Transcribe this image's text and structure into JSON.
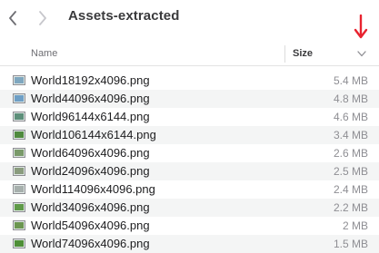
{
  "window": {
    "title": "Assets-extracted",
    "back_icon": "chevron-left-icon",
    "forward_icon": "chevron-right-icon"
  },
  "annotation": {
    "icon": "red-down-arrow-icon",
    "color": "#e8232f"
  },
  "table": {
    "columns": {
      "name": "Name",
      "size": "Size",
      "sort_icon": "chevron-down-icon"
    },
    "rows": [
      {
        "name": "World18192x4096.png",
        "size": "5.4 MB",
        "thumb_color": "#7fa7bf"
      },
      {
        "name": "World44096x4096.png",
        "size": "4.8 MB",
        "thumb_color": "#6e9fc6"
      },
      {
        "name": "World96144x6144.png",
        "size": "4.6 MB",
        "thumb_color": "#5d8f7a"
      },
      {
        "name": "World106144x6144.png",
        "size": "3.4 MB",
        "thumb_color": "#4f8a3e"
      },
      {
        "name": "World64096x4096.png",
        "size": "2.6 MB",
        "thumb_color": "#7a9a6a"
      },
      {
        "name": "World24096x4096.png",
        "size": "2.5 MB",
        "thumb_color": "#8a9c7e"
      },
      {
        "name": "World114096x4096.png",
        "size": "2.4 MB",
        "thumb_color": "#a7b0ad"
      },
      {
        "name": "World34096x4096.png",
        "size": "2.2 MB",
        "thumb_color": "#5f9a48"
      },
      {
        "name": "World54096x4096.png",
        "size": "2 MB",
        "thumb_color": "#6b9650"
      },
      {
        "name": "World74096x4096.png",
        "size": "1.5 MB",
        "thumb_color": "#4e8f37"
      }
    ]
  }
}
